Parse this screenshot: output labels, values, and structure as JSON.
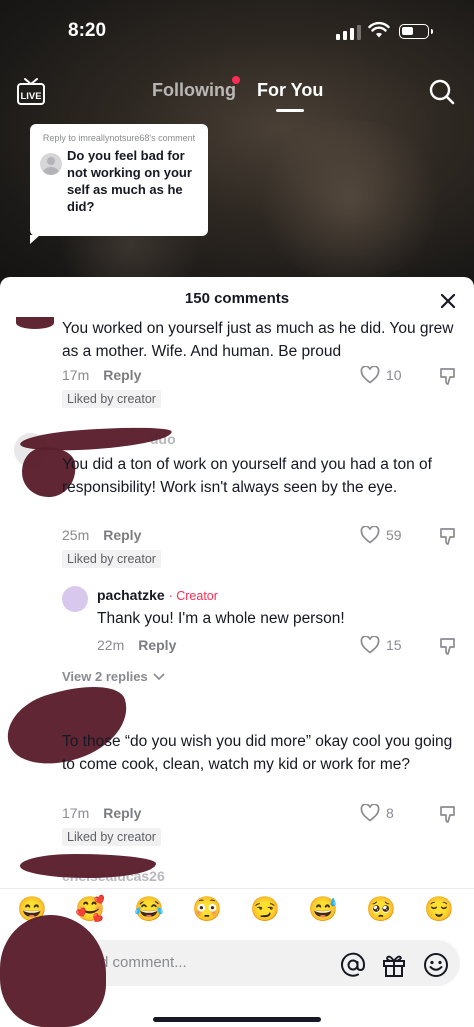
{
  "status_bar": {
    "time": "8:20"
  },
  "top_nav": {
    "live_label": "LIVE",
    "tabs": [
      {
        "label": "Following"
      },
      {
        "label": "For You"
      }
    ]
  },
  "reply_sticker": {
    "header": "Reply to imreallynotsure68's comment",
    "text": "Do you feel bad for not working on your self as much as he did?"
  },
  "sheet": {
    "title": "150 comments"
  },
  "comments": [
    {
      "text": "You worked on yourself just as much as he did. You grew as a mother. Wife. And human. Be proud",
      "time": "17m",
      "reply_label": "Reply",
      "likes": "10",
      "badge": "Liked by creator"
    },
    {
      "username_fragment": "ddo",
      "text": "You did a ton of work on yourself and you had a ton of responsibility! Work isn't always seen by the eye.",
      "time": "25m",
      "reply_label": "Reply",
      "likes": "59",
      "badge": "Liked by creator",
      "reply": {
        "username": "pachatzke",
        "creator_tag": "· Creator",
        "text": "Thank you! I'm a whole new person!",
        "time": "22m",
        "reply_label": "Reply",
        "likes": "15"
      },
      "view_replies": "View 2 replies"
    },
    {
      "text": "To those “do you wish you did more” okay cool you going to come cook, clean, watch my kid or work for me?",
      "time": "17m",
      "reply_label": "Reply",
      "likes": "8",
      "badge": "Liked by creator"
    },
    {
      "username_fragment": "chelsealucas26"
    }
  ],
  "emoji_bar": [
    "😄",
    "🥰",
    "😂",
    "😳",
    "😏",
    "😅",
    "🥺",
    "😌"
  ],
  "comment_input": {
    "placeholder": "d comment..."
  },
  "colors": {
    "accent": "#fe2c55",
    "sheet_bg": "#ffffff",
    "muted_text": "#8a8b91"
  }
}
